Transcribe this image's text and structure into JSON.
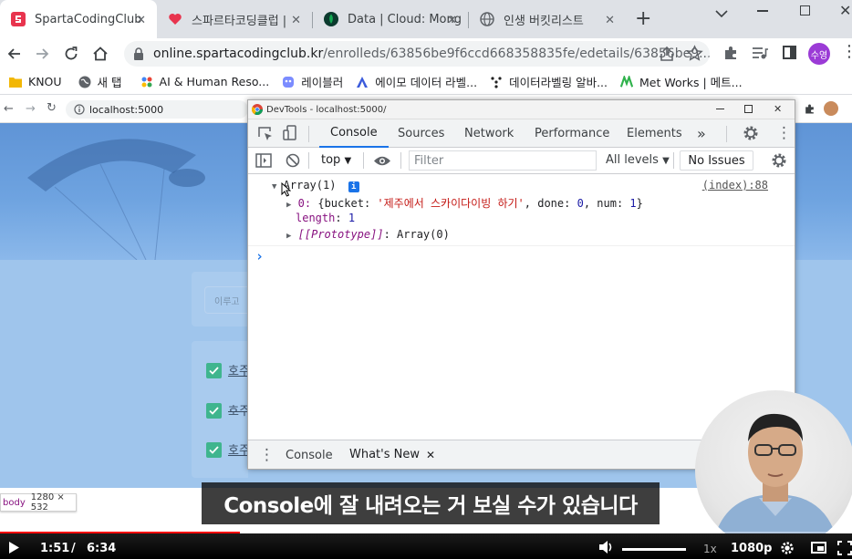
{
  "browser": {
    "tabs": [
      {
        "label": "SpartaCodingClub",
        "active": true
      },
      {
        "label": "스파르타코딩클럽 |",
        "active": false
      },
      {
        "label": "Data | Cloud: Mong",
        "active": false
      },
      {
        "label": "인생 버킷리스트",
        "active": false
      }
    ],
    "url_host": "online.spartacodingclub.kr",
    "url_path": "/enrolleds/63856be9f6ccd668358835fe/edetails/63856be9...",
    "profile_label": "수영",
    "bookmarks": [
      "KNOU",
      "새 탭",
      "AI & Human Reso...",
      "레이블러",
      "에이모 데이터 라벨...",
      "데이터라벨링 알바...",
      "Met Works | 메트..."
    ]
  },
  "inner_browser": {
    "url": "localhost:5000",
    "input_placeholder": "이루고",
    "items": [
      "호주",
      "호주",
      "호주"
    ],
    "body_badge_tag": "body",
    "body_badge_size": "1280 × 532"
  },
  "devtools": {
    "title": "DevTools - localhost:5000/",
    "tabs": [
      "Console",
      "Sources",
      "Network",
      "Performance",
      "Elements"
    ],
    "more_tabs": "»",
    "context": "top",
    "filter_placeholder": "Filter",
    "levels": "All levels",
    "issues": "No Issues",
    "source_link": "(index):88",
    "console": {
      "array_label": "Array(1)",
      "info_badge": "i",
      "item_index": "0:",
      "item_key1": "bucket",
      "item_val1": "'제주에서 스카이다이빙 하기'",
      "item_key2": "done",
      "item_val2": "0",
      "item_key3": "num",
      "item_val3": "1",
      "length_key": "length",
      "length_val": "1",
      "proto_key": "[[Prototype]]",
      "proto_val": "Array(0)",
      "prompt": "›"
    },
    "drawer_tabs": [
      "Console",
      "What's New"
    ]
  },
  "video": {
    "subtitle": "Console에 잘 내려오는 거 보실 수가 있습니다",
    "time_current": "1:51",
    "time_separator": "/",
    "time_total": "6:34",
    "speed": "1x",
    "quality": "1080p",
    "progress": 0.282
  }
}
